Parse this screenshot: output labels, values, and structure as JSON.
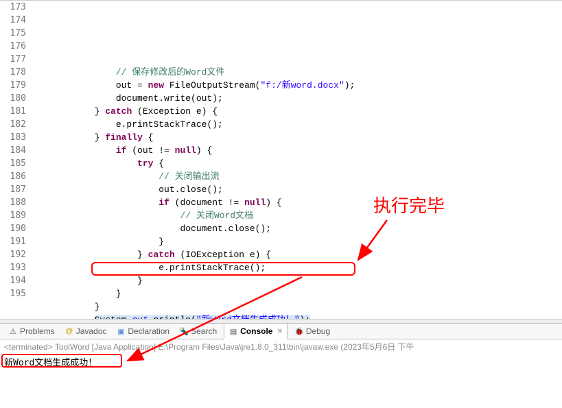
{
  "gutter": {
    "start": 173,
    "end": 195
  },
  "code": [
    {
      "indent": "                ",
      "tokens": [
        {
          "cls": "tok-comm",
          "txt": "// 保存修改后的Word文件"
        }
      ]
    },
    {
      "indent": "                ",
      "tokens": [
        {
          "cls": "tok-plain",
          "txt": "out = "
        },
        {
          "cls": "tok-kw",
          "txt": "new"
        },
        {
          "cls": "tok-plain",
          "txt": " FileOutputStream("
        },
        {
          "cls": "tok-str",
          "txt": "\"f:/新word.docx\""
        },
        {
          "cls": "tok-plain",
          "txt": ");"
        }
      ]
    },
    {
      "indent": "                ",
      "tokens": [
        {
          "cls": "tok-plain",
          "txt": "document.write(out);"
        }
      ]
    },
    {
      "indent": "            ",
      "tokens": [
        {
          "cls": "tok-plain",
          "txt": "} "
        },
        {
          "cls": "tok-kw",
          "txt": "catch"
        },
        {
          "cls": "tok-plain",
          "txt": " (Exception e) {"
        }
      ]
    },
    {
      "indent": "                ",
      "tokens": [
        {
          "cls": "tok-plain",
          "txt": "e.printStackTrace();"
        }
      ]
    },
    {
      "indent": "            ",
      "tokens": [
        {
          "cls": "tok-plain",
          "txt": "} "
        },
        {
          "cls": "tok-kw",
          "txt": "finally"
        },
        {
          "cls": "tok-plain",
          "txt": " {"
        }
      ]
    },
    {
      "indent": "                ",
      "tokens": [
        {
          "cls": "tok-kw",
          "txt": "if"
        },
        {
          "cls": "tok-plain",
          "txt": " (out != "
        },
        {
          "cls": "tok-kw",
          "txt": "null"
        },
        {
          "cls": "tok-plain",
          "txt": ") {"
        }
      ]
    },
    {
      "indent": "                    ",
      "tokens": [
        {
          "cls": "tok-kw",
          "txt": "try"
        },
        {
          "cls": "tok-plain",
          "txt": " {"
        }
      ]
    },
    {
      "indent": "                        ",
      "tokens": [
        {
          "cls": "tok-comm",
          "txt": "// 关闭输出流"
        }
      ]
    },
    {
      "indent": "                        ",
      "tokens": [
        {
          "cls": "tok-plain",
          "txt": "out.close();"
        }
      ]
    },
    {
      "indent": "                        ",
      "tokens": [
        {
          "cls": "tok-kw",
          "txt": "if"
        },
        {
          "cls": "tok-plain",
          "txt": " (document != "
        },
        {
          "cls": "tok-kw",
          "txt": "null"
        },
        {
          "cls": "tok-plain",
          "txt": ") {"
        }
      ]
    },
    {
      "indent": "                            ",
      "tokens": [
        {
          "cls": "tok-comm",
          "txt": "// 关闭Word文档"
        }
      ]
    },
    {
      "indent": "                            ",
      "tokens": [
        {
          "cls": "tok-plain",
          "txt": "document.close();"
        }
      ]
    },
    {
      "indent": "                        ",
      "tokens": [
        {
          "cls": "tok-plain",
          "txt": "}"
        }
      ]
    },
    {
      "indent": "                    ",
      "tokens": [
        {
          "cls": "tok-plain",
          "txt": "} "
        },
        {
          "cls": "tok-kw",
          "txt": "catch"
        },
        {
          "cls": "tok-plain",
          "txt": " (IOException e) {"
        }
      ]
    },
    {
      "indent": "                        ",
      "tokens": [
        {
          "cls": "tok-plain",
          "txt": "e.printStackTrace();"
        }
      ]
    },
    {
      "indent": "                    ",
      "tokens": [
        {
          "cls": "tok-plain",
          "txt": "}"
        }
      ]
    },
    {
      "indent": "                ",
      "tokens": [
        {
          "cls": "tok-plain",
          "txt": "}"
        }
      ]
    },
    {
      "indent": "            ",
      "tokens": [
        {
          "cls": "tok-plain",
          "txt": "}"
        }
      ]
    },
    {
      "indent": "            ",
      "sel": true,
      "tokens": [
        {
          "cls": "tok-plain",
          "txt": "System."
        },
        {
          "cls": "tok-field",
          "txt": "out"
        },
        {
          "cls": "tok-plain",
          "txt": ".println("
        },
        {
          "cls": "tok-str",
          "txt": "\"新Word文档生成成功！\""
        },
        {
          "cls": "tok-plain",
          "txt": ");"
        }
      ]
    },
    {
      "indent": "        ",
      "tokens": [
        {
          "cls": "tok-plain",
          "txt": "}"
        }
      ]
    },
    {
      "indent": "",
      "tokens": []
    }
  ],
  "annotation": {
    "label": "执行完毕"
  },
  "tabs": {
    "problems": "Problems",
    "javadoc": "Javadoc",
    "declaration": "Declaration",
    "search": "Search",
    "console": "Console",
    "debug": "Debug"
  },
  "console": {
    "header": "<terminated> ToolWord [Java Application] E:\\Program Files\\Java\\jre1.8.0_311\\bin\\javaw.exe  (2023年5月6日 下午",
    "output": "新Word文档生成成功！"
  }
}
